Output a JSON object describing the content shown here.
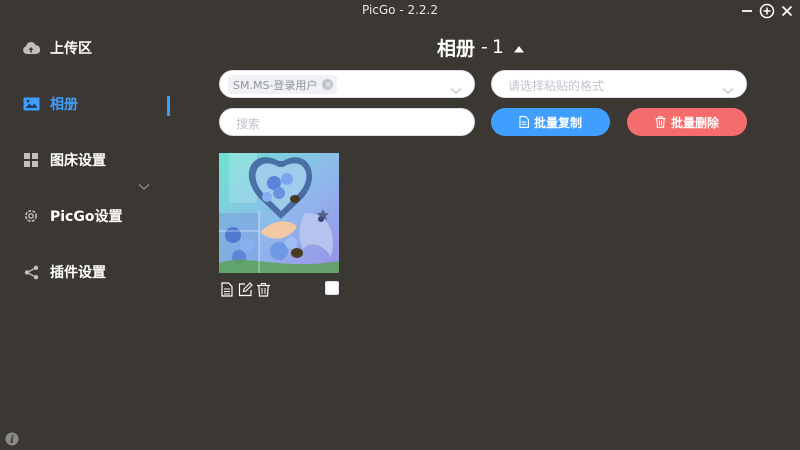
{
  "window": {
    "title": "PicGo - 2.2.2"
  },
  "sidebar": {
    "items": [
      {
        "label": "上传区",
        "icon": "cloud-upload-icon"
      },
      {
        "label": "相册",
        "icon": "image-icon",
        "active": true
      },
      {
        "label": "图床设置",
        "icon": "grid-icon"
      },
      {
        "label": "PicGo设置",
        "icon": "gear-icon"
      },
      {
        "label": "插件设置",
        "icon": "share-icon"
      }
    ]
  },
  "gallery": {
    "title": "相册",
    "separator": "-",
    "count": "1",
    "filter": {
      "selected_tag": "SM.MS-登录用户",
      "paste_format_placeholder": "请选择粘贴的格式",
      "search_placeholder": "搜索"
    },
    "actions": {
      "copy_label": "批量复制",
      "delete_label": "批量删除"
    },
    "items": [
      {
        "checked": false
      }
    ]
  },
  "colors": {
    "background": "#3b3733",
    "accent": "#409eff",
    "danger": "#f56c6c"
  }
}
